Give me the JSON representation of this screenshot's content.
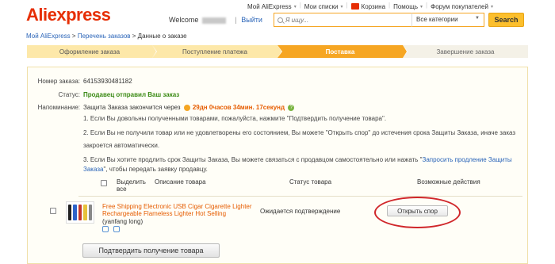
{
  "logo": {
    "part1": "Ali",
    "part2": "express"
  },
  "header": {
    "welcome": "Welcome",
    "logout": "Выйти",
    "nav": [
      {
        "label": "Мой AliExpress",
        "chev": "▾"
      },
      {
        "label": "Мои списки",
        "chev": "▾"
      },
      {
        "label": "Корзина",
        "chev": ""
      },
      {
        "label": "Помощь",
        "chev": "▾"
      },
      {
        "label": "Форум покупателей",
        "chev": "▾"
      }
    ]
  },
  "search": {
    "placeholder": "Я ищу...",
    "category": "Все категории",
    "button": "Search"
  },
  "breadcrumb": {
    "home": "Мой AliExpress",
    "orders": "Перечень заказов",
    "sep": ">",
    "current": "Данные о заказе"
  },
  "steps": [
    {
      "label": "Оформление заказа",
      "state": "done"
    },
    {
      "label": "Поступление платежа",
      "state": "done"
    },
    {
      "label": "Поставка",
      "state": "active"
    },
    {
      "label": "Завершение заказа",
      "state": "todo"
    }
  ],
  "order": {
    "number_label": "Номер заказа:",
    "number": "64153930481182",
    "status_label": "Статус:",
    "status": "Продавец отправил Ваш заказ",
    "reminder_label": "Напоминание:",
    "reminder_text": "Защита Заказа закончится через",
    "timer": "29дн 0часов 34мин. 17секунд",
    "help_icon": "?",
    "notes": {
      "n1": "1. Если Вы довольны полученными товарами, пожалуйста, нажмите \"Подтвердить получение товара\".",
      "n2": "2. Если Вы не получили товар или не удовлетворены его состоянием, Вы можете \"Открыть спор\" до истечения срока Защиты Заказа, иначе заказ",
      "n2b": "закроется автоматически.",
      "n3a": "3. Если Вы хотите продлить срок Защиты Заказа, Вы можете связаться с продавцом самостоятельно или нажать \"",
      "n3link": "Запросить продление Защиты",
      "n3link2": "Заказа",
      "n3b": "\", чтобы передать заявку продавцу."
    }
  },
  "table": {
    "select_all": "Выделить все",
    "col_desc": "Описание товара",
    "col_status": "Статус товара",
    "col_actions": "Возможные действия"
  },
  "product": {
    "title": "Free Shipping Electronic USB Cigar Cigarette Lighter Rechargeable Flameless Lighter Hot Selling",
    "seller": "(yanfang long)",
    "status": "Ожидается подтверждение",
    "dispute": "Открыть спор",
    "swatch_colors": [
      "#222222",
      "#2d63c9",
      "#c4362b",
      "#e7c23b",
      "#888888"
    ]
  },
  "confirm_button": "Подтвердить получение товара"
}
